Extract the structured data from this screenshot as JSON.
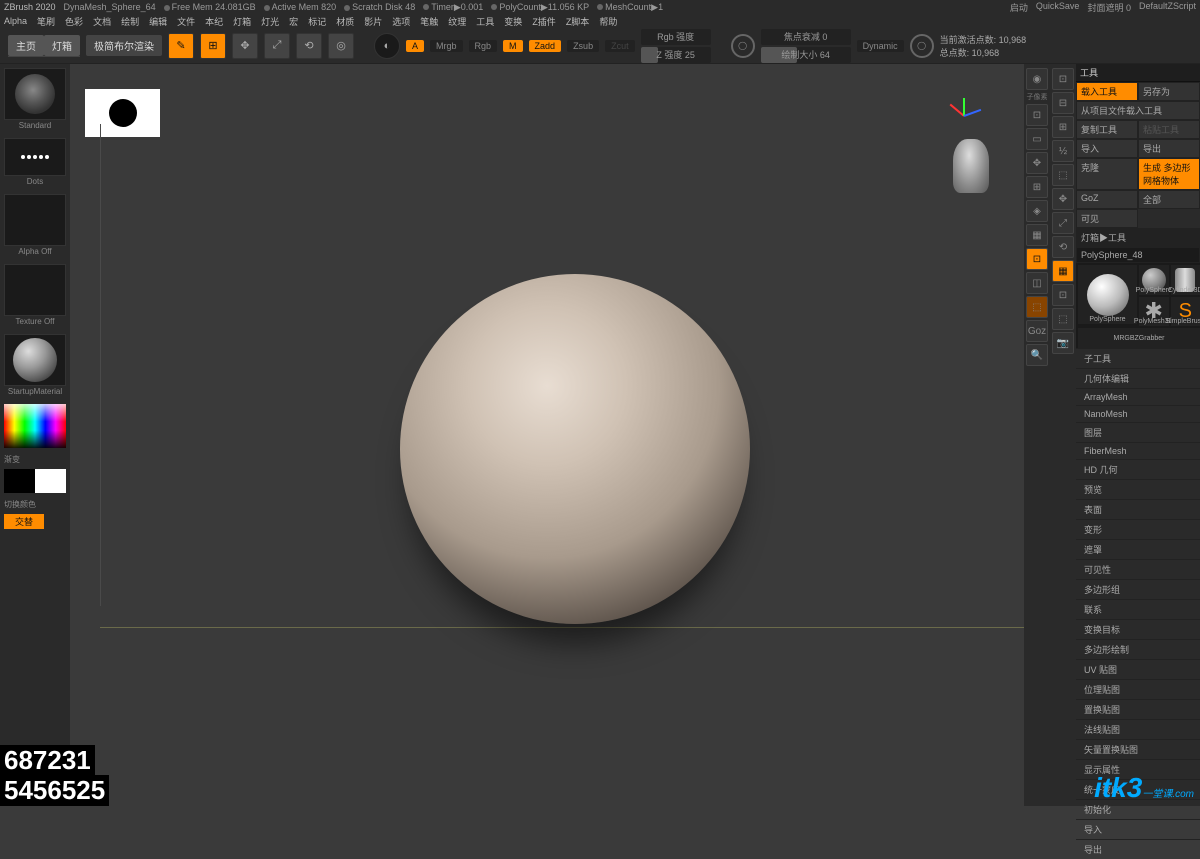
{
  "title": {
    "app": "ZBrush 2020",
    "doc": "DynaMesh_Sphere_64",
    "stats": [
      "Free Mem 24.081GB",
      "Active Mem 820",
      "Scratch Disk 48",
      "Timer▶0.001",
      "PolyCount▶11.056 KP",
      "MeshCount▶1"
    ],
    "right": [
      "启动",
      "QuickSave",
      "封面遮明 0",
      "DefaultZScript"
    ]
  },
  "menu": [
    "Alpha",
    "笔刷",
    "色彩",
    "文档",
    "绘制",
    "编辑",
    "文件",
    "本纪",
    "灯箱",
    "灯光",
    "宏",
    "标记",
    "材质",
    "影片",
    "选项",
    "笔触",
    "纹理",
    "工具",
    "变换",
    "Z插件",
    "Z脚本",
    "帮助"
  ],
  "tabs": {
    "main": "主页",
    "lightbox": "灯箱",
    "decimate": "极简布尔渲染"
  },
  "mode": {
    "mrgb": "Mrgb",
    "rgb": "Rgb",
    "m": "M",
    "zadd": "Zadd",
    "zsub": "Zsub",
    "zcut": "Zcut",
    "a": "A"
  },
  "sliders": {
    "rgb": "Rgb 强度",
    "z": "Z 强度 25",
    "focal": "焦点衰减 0",
    "draw": "绘制大小 64",
    "dyn": "Dynamic"
  },
  "info": {
    "active": "当前激活点数: 10,968",
    "total": "总点数: 10,968"
  },
  "left": {
    "brush": "Standard",
    "stroke": "Dots",
    "alpha": "Alpha Off",
    "texture": "Texture Off",
    "material": "StartupMaterial",
    "grad": "渐变",
    "swatch": "切换颜色",
    "ex": "交替"
  },
  "rcol1": [
    "◯",
    "⌂",
    "※",
    "✎",
    "⟲",
    "◈",
    "▦",
    "⊞",
    "⬚",
    "⊡",
    "Goz",
    "◎"
  ],
  "rcol2": [
    "⊡",
    "⊟",
    "⊞",
    "⬚",
    "⊡",
    "⬚",
    "◈",
    "▦",
    "◫",
    "⊡",
    "⬚",
    "⊟"
  ],
  "rightPanel": {
    "title": "工具",
    "buttons": {
      "import": "载入工具",
      "saveas": "另存为",
      "fromfile": "从项目文件载入工具",
      "copy": "复制工具",
      "paste": "粘贴工具",
      "imp": "导入",
      "exp": "导出",
      "clone": "克隆",
      "make": "生成 多边形网格物体",
      "goz": "GoZ",
      "all": "全部",
      "vis": "可见",
      "expand": "灯箱▶工具",
      "current": "PolySphere_48"
    },
    "thumbs": [
      "PolySphere",
      "PolySphere",
      "Cylinder3D",
      "PolyMesh3D",
      "SimpleBrush",
      "MRGBZGrabber"
    ],
    "accordion": [
      "子工具",
      "几何体编辑",
      "ArrayMesh",
      "NanoMesh",
      "图层",
      "FiberMesh",
      "HD 几何",
      "预览",
      "表面",
      "变形",
      "遮罩",
      "可见性",
      "多边形组",
      "联系",
      "变换目标",
      "多边形绘制",
      "UV 贴图",
      "位理贴图",
      "置换贴图",
      "法线贴图",
      "矢量置换贴图",
      "显示属性",
      "统一蒙皮",
      "初始化",
      "导入",
      "导出"
    ]
  },
  "overlay": {
    "n1": "687231",
    "n2": "5456525",
    "wm": "itk3",
    "wmsub": "一堂课",
    "wmurl": ".com"
  }
}
